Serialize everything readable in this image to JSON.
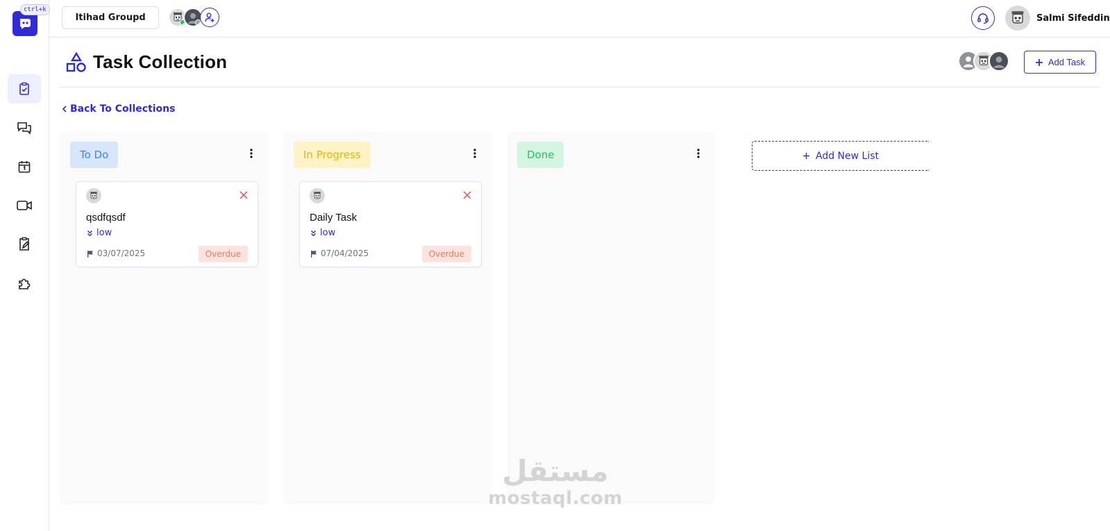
{
  "sidebar": {
    "shortcut": "ctrl+k",
    "items": [
      {
        "name": "tasks",
        "icon": "clipboard-check-icon",
        "active": true
      },
      {
        "name": "chat",
        "icon": "chat-bubbles-icon",
        "active": false
      },
      {
        "name": "calendar",
        "icon": "calendar-icon",
        "active": false
      },
      {
        "name": "meetings",
        "icon": "video-camera-icon",
        "active": false
      },
      {
        "name": "notes",
        "icon": "clipboard-pen-icon",
        "active": false
      },
      {
        "name": "integrations",
        "icon": "puzzle-icon",
        "active": false
      }
    ]
  },
  "topbar": {
    "group_name": "Itihad Groupd",
    "user_name": "Salmi Sifeddine"
  },
  "header": {
    "title": "Task Collection",
    "add_task_label": "Add Task"
  },
  "back_link": "Back To Collections",
  "board": {
    "columns": [
      {
        "title": "To Do",
        "badge_bg": "#d8e6fb",
        "badge_color": "#3b82f6",
        "cards": [
          {
            "title": "qsdfqsdf",
            "priority": "low",
            "due": "03/07/2025",
            "status": "Overdue"
          }
        ]
      },
      {
        "title": "In Progress",
        "badge_bg": "#fdf3c4",
        "badge_color": "#eab308",
        "cards": [
          {
            "title": "Daily Task",
            "priority": "low",
            "due": "07/04/2025",
            "status": "Overdue"
          }
        ]
      },
      {
        "title": "Done",
        "badge_bg": "#d5f5e3",
        "badge_color": "#22c55e",
        "cards": []
      }
    ],
    "add_list_label": "Add New List"
  },
  "watermark": {
    "arabic": "مستقل",
    "latin": "mostaql.com"
  },
  "colors": {
    "accent": "#2f2bd9",
    "overdue_bg": "#fde2df",
    "overdue_text": "#f07a4a",
    "online": "#22c55e"
  }
}
